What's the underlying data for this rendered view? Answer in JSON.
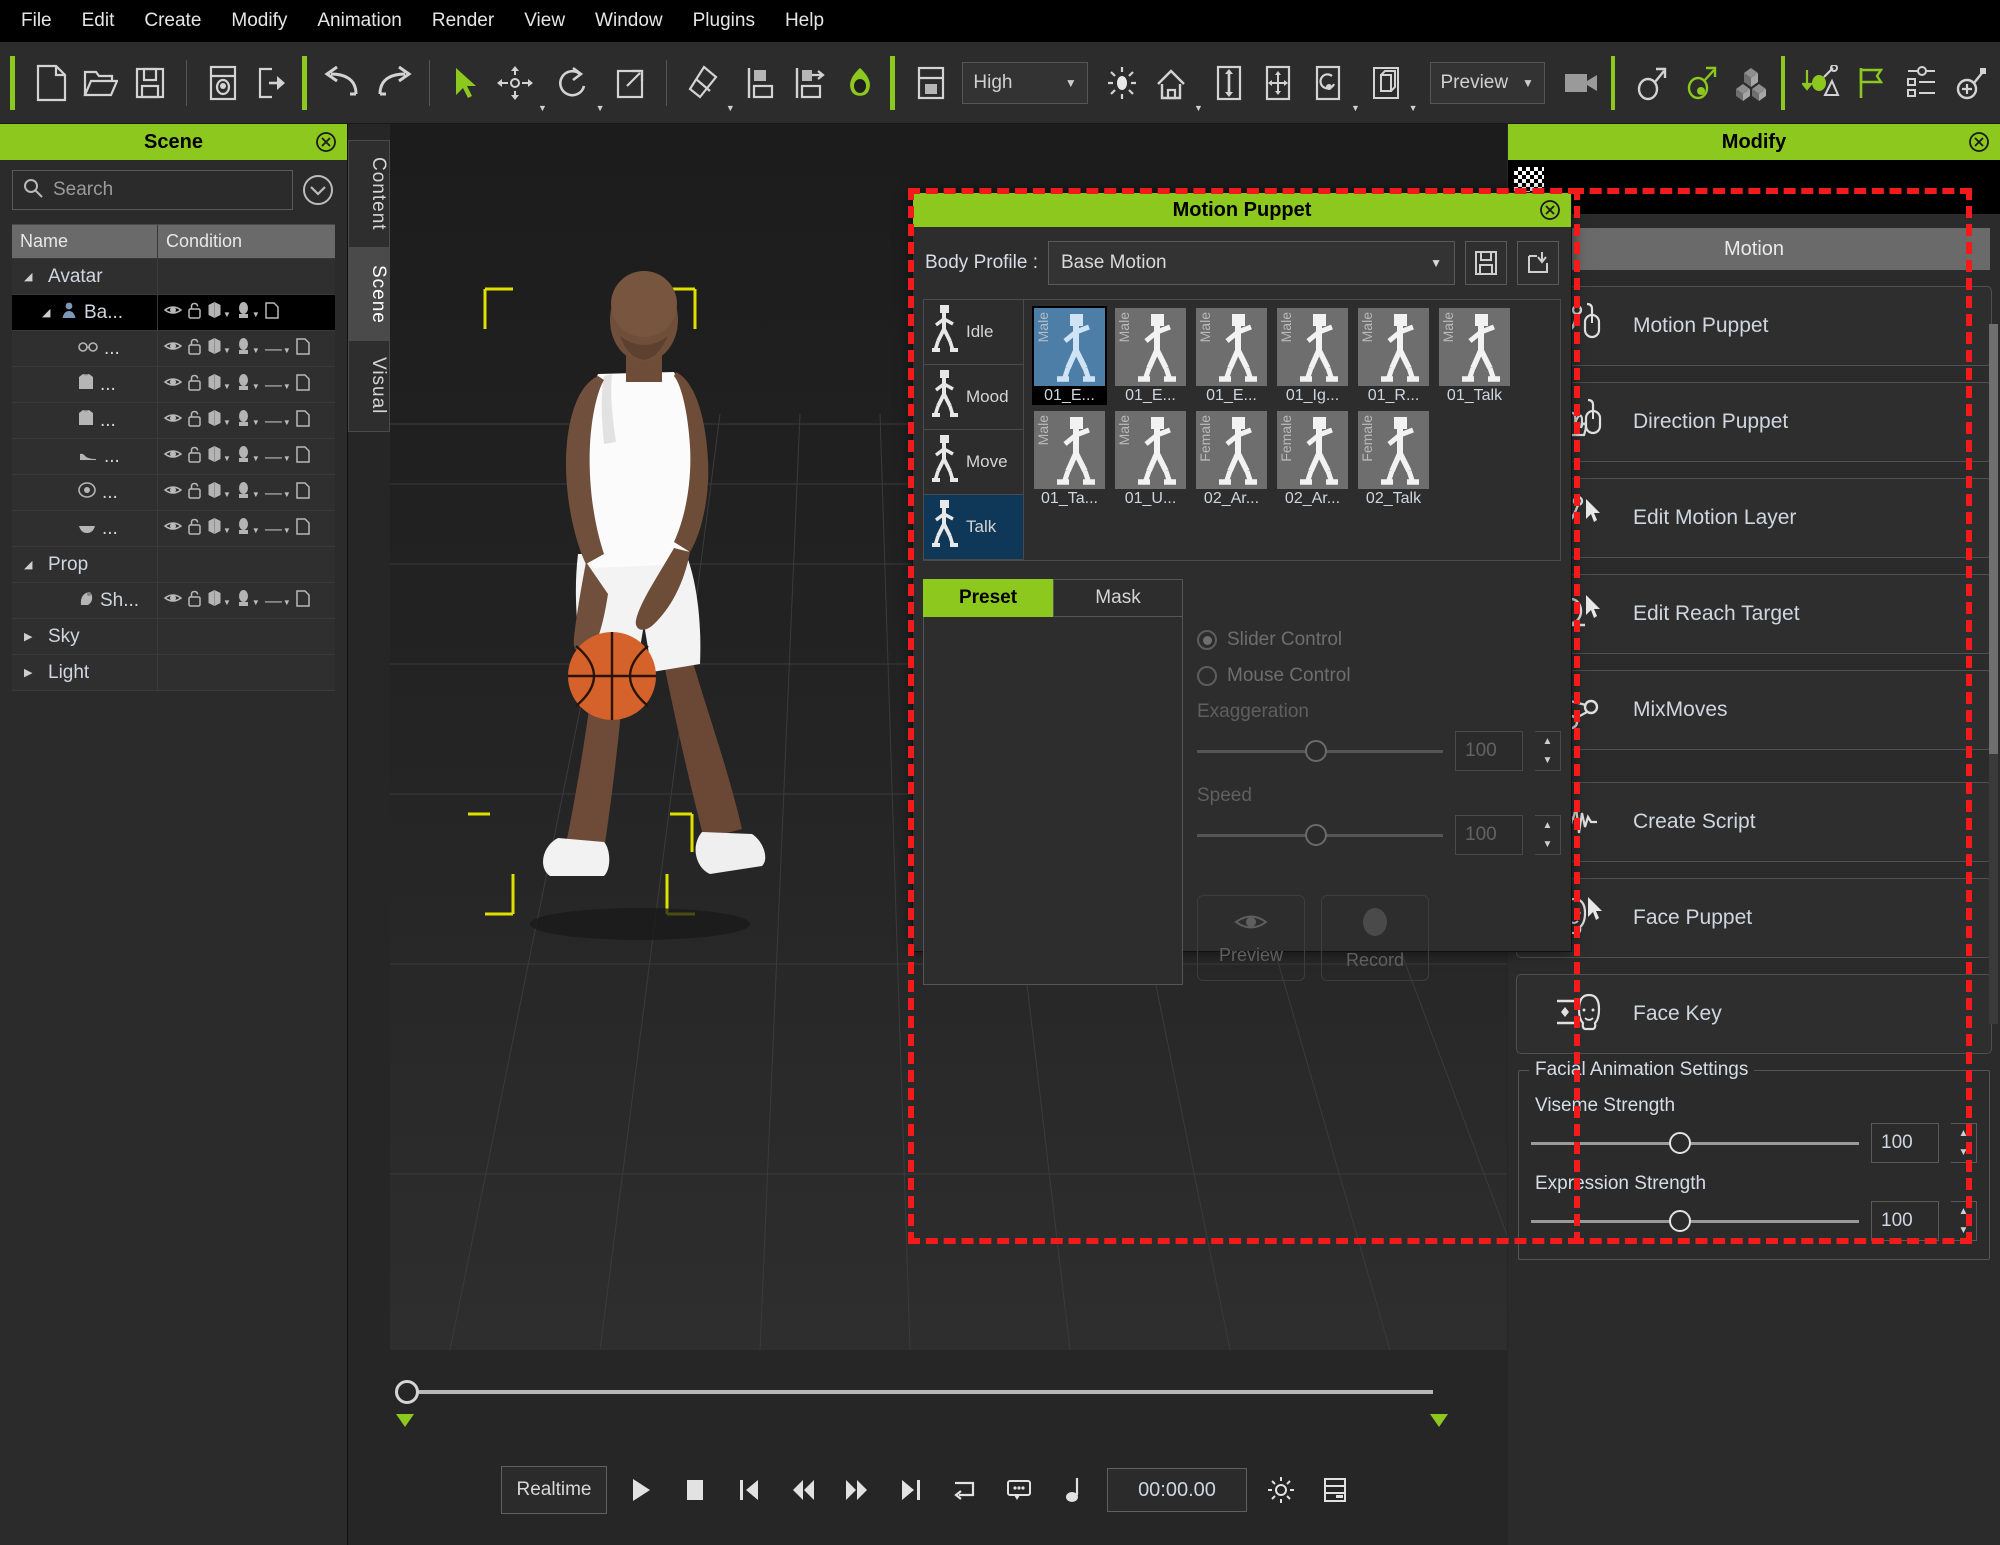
{
  "menu": {
    "items": [
      "File",
      "Edit",
      "Create",
      "Modify",
      "Animation",
      "Render",
      "View",
      "Window",
      "Plugins",
      "Help"
    ]
  },
  "toolbar": {
    "quality_value": "High",
    "render_mode_value": "Preview",
    "icons": [
      "new-file-icon",
      "open-folder-icon",
      "save-icon",
      "project-icon",
      "export-icon",
      "undo-icon",
      "redo-icon",
      "select-arrow-icon",
      "move-icon",
      "rotate-icon",
      "scale-icon",
      "transform-icon",
      "align-icon",
      "align-export-icon",
      "render-ball-icon",
      "display-panel-icon",
      "light-icon",
      "home-view-icon",
      "vertical-fit-icon",
      "move-view-icon",
      "orbit-icon",
      "box-view-icon",
      "camera-icon",
      "gender-male-icon",
      "avatar-edit-icon",
      "blocks-icon",
      "drop-to-floor-icon",
      "flag-icon",
      "list-settings-icon",
      "add-target-icon"
    ]
  },
  "scene_panel": {
    "title": "Scene",
    "search_placeholder": "Search",
    "columns": [
      "Name",
      "Condition"
    ],
    "rows": [
      {
        "indent": 0,
        "tri": "open",
        "icon": "none",
        "label": "Avatar",
        "selected": false,
        "has_condition": false
      },
      {
        "indent": 1,
        "tri": "open",
        "icon": "person-icon",
        "label": "Ba...",
        "selected": true,
        "has_condition": true
      },
      {
        "indent": 2,
        "tri": "none",
        "icon": "glasses-icon",
        "label": "...",
        "selected": false,
        "has_condition": true
      },
      {
        "indent": 2,
        "tri": "none",
        "icon": "shirt-icon",
        "label": "...",
        "selected": false,
        "has_condition": true
      },
      {
        "indent": 2,
        "tri": "none",
        "icon": "shirt-icon",
        "label": "...",
        "selected": false,
        "has_condition": true
      },
      {
        "indent": 2,
        "tri": "none",
        "icon": "shoe-icon",
        "label": "...",
        "selected": false,
        "has_condition": true
      },
      {
        "indent": 2,
        "tri": "none",
        "icon": "eye-icon",
        "label": "...",
        "selected": false,
        "has_condition": true
      },
      {
        "indent": 2,
        "tri": "none",
        "icon": "mouth-icon",
        "label": "...",
        "selected": false,
        "has_condition": true
      },
      {
        "indent": 0,
        "tri": "open",
        "icon": "none",
        "label": "Prop",
        "selected": false,
        "has_condition": false
      },
      {
        "indent": 2,
        "tri": "none",
        "icon": "ball-icon",
        "label": "Sh...",
        "selected": false,
        "has_condition": true
      },
      {
        "indent": 0,
        "tri": "closed",
        "icon": "none",
        "label": "Sky",
        "selected": false,
        "has_condition": false
      },
      {
        "indent": 0,
        "tri": "closed",
        "icon": "none",
        "label": "Light",
        "selected": false,
        "has_condition": false
      }
    ]
  },
  "vertical_tabs": [
    {
      "label": "Content",
      "active": false
    },
    {
      "label": "Scene",
      "active": true
    },
    {
      "label": "Visual",
      "active": false
    }
  ],
  "motion_puppet": {
    "title": "Motion Puppet",
    "body_profile_label": "Body Profile :",
    "body_profile_value": "Base Motion",
    "save_icon": "save-profile-icon",
    "load_icon": "load-profile-icon",
    "categories": [
      {
        "label": "Idle",
        "active": false
      },
      {
        "label": "Mood",
        "active": false
      },
      {
        "label": "Move",
        "active": false
      },
      {
        "label": "Talk",
        "active": true
      }
    ],
    "thumbnails": [
      {
        "caption": "01_E...",
        "gender": "Male",
        "selected": true
      },
      {
        "caption": "01_E...",
        "gender": "Male",
        "selected": false
      },
      {
        "caption": "01_E...",
        "gender": "Male",
        "selected": false
      },
      {
        "caption": "01_Ig...",
        "gender": "Male",
        "selected": false
      },
      {
        "caption": "01_R...",
        "gender": "Male",
        "selected": false
      },
      {
        "caption": "01_Talk",
        "gender": "Male",
        "selected": false
      },
      {
        "caption": "01_Ta...",
        "gender": "Male",
        "selected": false
      },
      {
        "caption": "01_U...",
        "gender": "Male",
        "selected": false
      },
      {
        "caption": "02_Ar...",
        "gender": "Female",
        "selected": false
      },
      {
        "caption": "02_Ar...",
        "gender": "Female",
        "selected": false
      },
      {
        "caption": "02_Talk",
        "gender": "Female",
        "selected": false
      }
    ],
    "tabs": [
      {
        "label": "Preset",
        "active": true
      },
      {
        "label": "Mask",
        "active": false
      }
    ],
    "controls": {
      "slider_control_label": "Slider Control",
      "mouse_control_label": "Mouse Control",
      "slider_control_selected": true,
      "exaggeration_label": "Exaggeration",
      "exaggeration_value": "100",
      "speed_label": "Speed",
      "speed_value": "100",
      "preview_label": "Preview",
      "record_label": "Record"
    }
  },
  "modify_panel": {
    "title": "Modify",
    "section_title": "Motion",
    "items": [
      {
        "label": "Motion Puppet",
        "icon": "motion-puppet-icon"
      },
      {
        "label": "Direction Puppet",
        "icon": "direction-puppet-icon"
      },
      {
        "label": "Edit Motion Layer",
        "icon": "edit-motion-layer-icon"
      },
      {
        "label": "Edit Reach Target",
        "icon": "edit-reach-target-icon"
      },
      {
        "label": "MixMoves",
        "icon": "mixmoves-icon"
      },
      {
        "label": "Create Script",
        "icon": "create-script-icon"
      },
      {
        "label": "Face Puppet",
        "icon": "face-puppet-icon"
      },
      {
        "label": "Face Key",
        "icon": "face-key-icon"
      }
    ],
    "facial_settings": {
      "group_label": "Facial Animation Settings",
      "viseme_label": "Viseme Strength",
      "viseme_value": "100",
      "expression_label": "Expression Strength",
      "expression_value": "100"
    }
  },
  "timeline": {
    "realtime_label": "Realtime",
    "timecode": "00:00.00",
    "transport_icons": [
      "play-icon",
      "stop-icon",
      "jump-start-icon",
      "prev-frame-icon",
      "next-frame-icon",
      "jump-end-icon",
      "loop-icon",
      "subtitle-icon",
      "audio-note-icon",
      "settings-gear-icon",
      "track-list-icon"
    ]
  },
  "colors": {
    "accent_green": "#8dc81e",
    "highlight_red": "#f21b1b",
    "selection_blue": "#4d7ea8"
  }
}
